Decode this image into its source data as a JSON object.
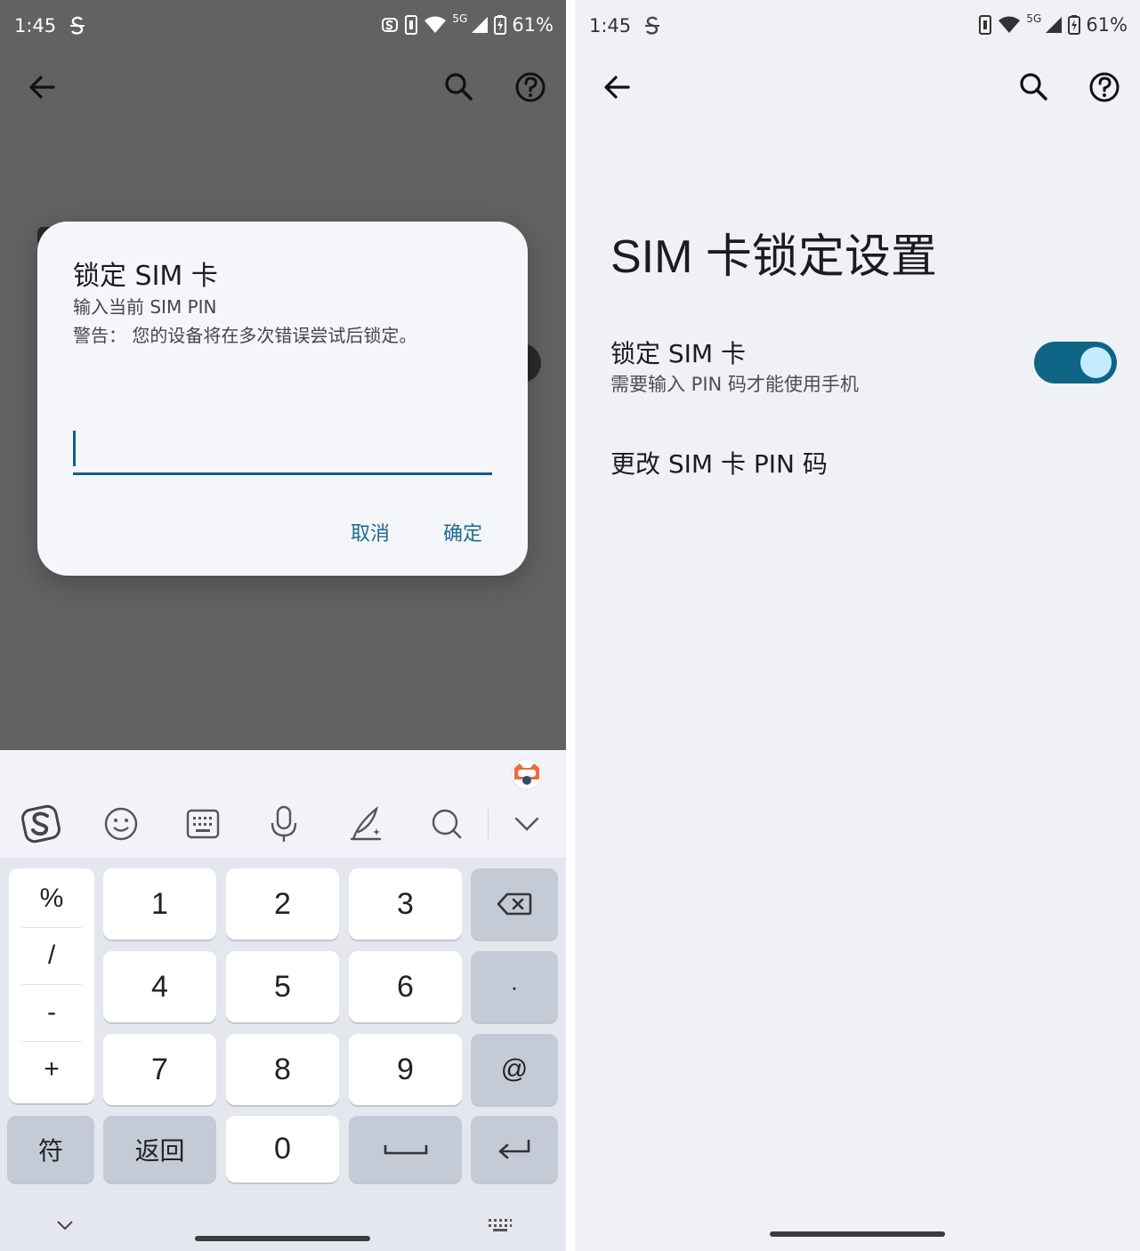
{
  "status_bar": {
    "time": "1:45",
    "network": "5G",
    "battery": "61%"
  },
  "dialog": {
    "title": "锁定 SIM 卡",
    "subtitle": "输入当前 SIM PIN",
    "warning": "警告： 您的设备将在多次错误尝试后锁定。",
    "input_value": "",
    "cancel_label": "取消",
    "ok_label": "确定"
  },
  "keyboard": {
    "symbols": [
      "%",
      "/",
      "-",
      "+"
    ],
    "digits": [
      "1",
      "2",
      "3",
      "4",
      "5",
      "6",
      "7",
      "8",
      "9"
    ],
    "zero": "0",
    "dot": "·",
    "at": "@",
    "symbol_key": "符",
    "back_key": "返回",
    "toolbar_icons": [
      "sogou-logo-icon",
      "emoji-icon",
      "keyboard-icon",
      "microphone-icon",
      "handwriting-icon",
      "search-icon",
      "collapse-icon"
    ]
  },
  "settings": {
    "page_title": "SIM 卡锁定设置",
    "lock_sim": {
      "title": "锁定 SIM 卡",
      "summary": "需要输入 PIN 码才能使用手机",
      "enabled": true
    },
    "change_pin": {
      "title": "更改 SIM 卡 PIN 码"
    }
  },
  "colors": {
    "accent": "#116082",
    "toggle_track": "#0e6585",
    "toggle_thumb": "#c4ebfd",
    "scrim": "#626262"
  }
}
